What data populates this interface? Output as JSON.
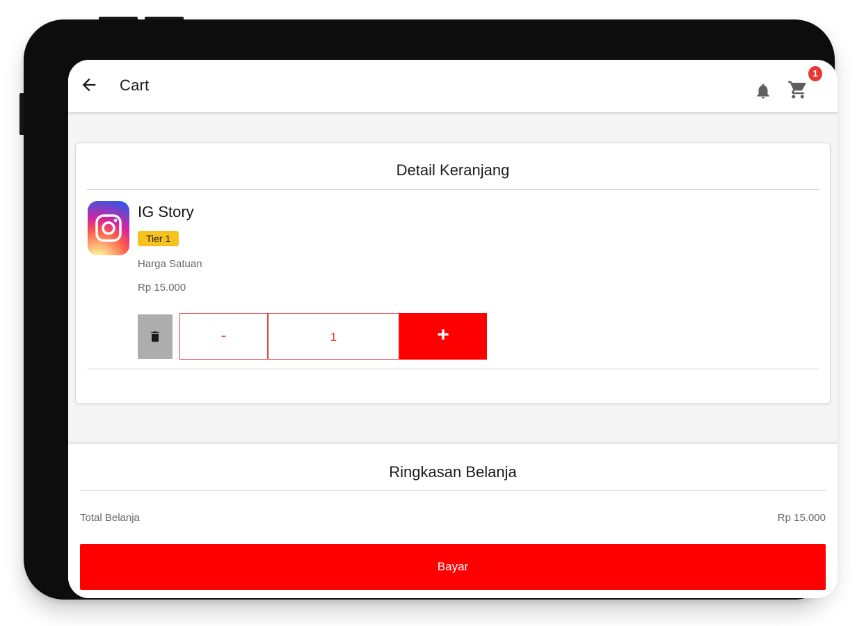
{
  "appbar": {
    "title": "Cart",
    "back_icon": "arrow-left-icon",
    "notification_icon": "bell-icon",
    "cart_icon": "cart-icon",
    "cart_badge": "1"
  },
  "detail": {
    "title": "Detail Keranjang",
    "item": {
      "name": "IG Story",
      "icon": "instagram-icon",
      "tier": "Tier 1",
      "unit_price_label": "Harga Satuan",
      "unit_price": "Rp 15.000",
      "quantity": "1",
      "decrement_label": "-",
      "increment_label": "+",
      "delete_icon": "trash-icon"
    }
  },
  "summary": {
    "title": "Ringkasan Belanja",
    "total_label": "Total Belanja",
    "total_value": "Rp 15.000",
    "pay_label": "Bayar"
  },
  "colors": {
    "accent": "#ff0000",
    "badge": "#e53935",
    "tier": "#f7c21e",
    "delete_button": "#adadad"
  }
}
